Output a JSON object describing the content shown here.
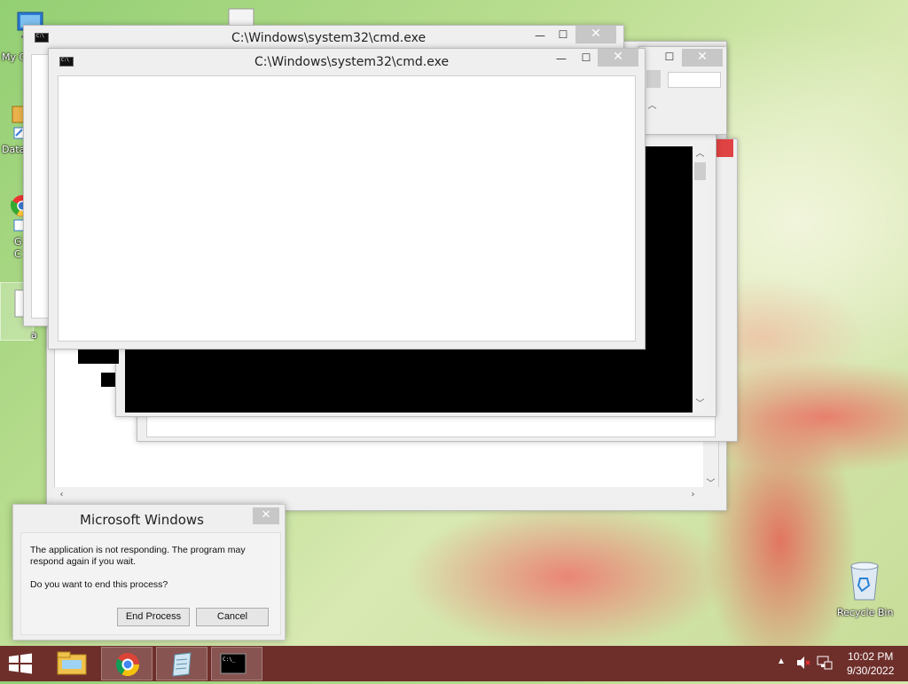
{
  "desktop": {
    "icons": [
      {
        "name": "my-computer",
        "label": "My C"
      },
      {
        "name": "data",
        "label": "Data"
      },
      {
        "name": "chrome",
        "label": "G\nC"
      },
      {
        "name": "doc",
        "label": "a"
      }
    ],
    "recycle_bin_label": "Recycle Bin"
  },
  "windows": {
    "cmd_back_title": "C:\\Windows\\system32\\cmd.exe",
    "cmd_front_title": "C:\\Windows\\system32\\cmd.exe",
    "minimize_glyph": "—",
    "maximize_glyph": "☐",
    "close_glyph": "✕"
  },
  "dialog": {
    "title": "Microsoft Windows",
    "message": "The application is not responding. The program may respond again if you wait.",
    "question": "Do you want to end this process?",
    "end_process_label": "End Process",
    "cancel_label": "Cancel",
    "close_glyph": "✕"
  },
  "taskbar": {
    "clock_time": "10:02 PM",
    "clock_date": "9/30/2022",
    "colors": {
      "background": "#6e2f2b"
    }
  }
}
